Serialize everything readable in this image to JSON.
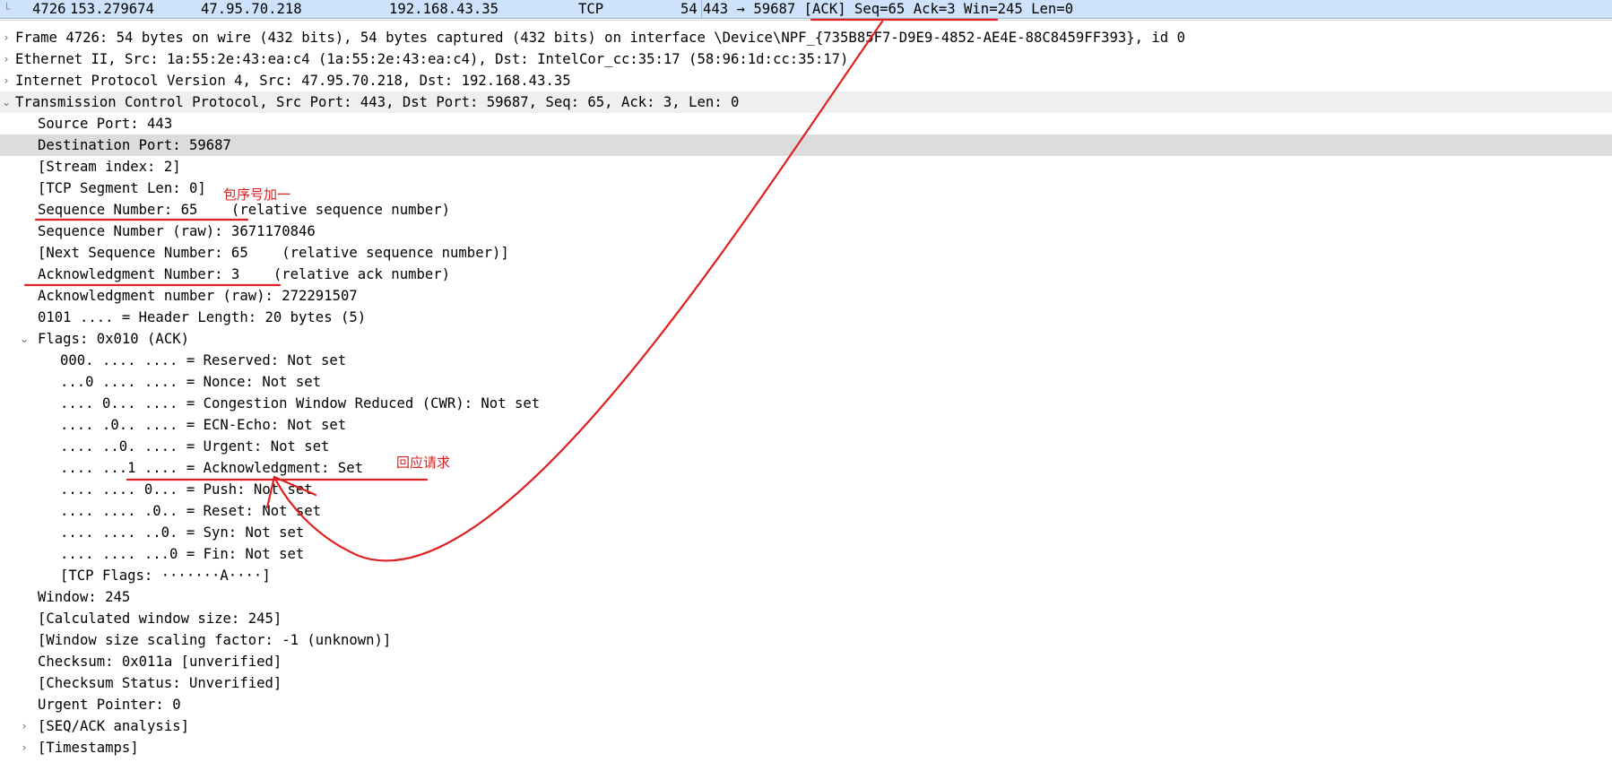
{
  "packet_list_row": {
    "number": "4726",
    "time": "153.279674",
    "source": "47.95.70.218",
    "destination": "192.168.43.35",
    "protocol": "TCP",
    "length": "54",
    "info": "443 → 59687 [ACK] Seq=65 Ack=3 Win=245 Len=0"
  },
  "tree": [
    {
      "text": "Frame 4726: 54 bytes on wire (432 bits), 54 bytes captured (432 bits) on interface \\Device\\NPF_{735B85F7-D9E9-4852-AE4E-88C8459FF393}, id 0",
      "depth": 0,
      "toggle": "collapsed"
    },
    {
      "text": "Ethernet II, Src: 1a:55:2e:43:ea:c4 (1a:55:2e:43:ea:c4), Dst: IntelCor_cc:35:17 (58:96:1d:cc:35:17)",
      "depth": 0,
      "toggle": "collapsed"
    },
    {
      "text": "Internet Protocol Version 4, Src: 47.95.70.218, Dst: 192.168.43.35",
      "depth": 0,
      "toggle": "collapsed"
    },
    {
      "text": "Transmission Control Protocol, Src Port: 443, Dst Port: 59687, Seq: 65, Ack: 3, Len: 0",
      "depth": 0,
      "toggle": "expanded"
    },
    {
      "text": "Source Port: 443",
      "depth": 1
    },
    {
      "text": "Destination Port: 59687",
      "depth": 1,
      "selected": true
    },
    {
      "text": "[Stream index: 2]",
      "depth": 1
    },
    {
      "text": "[TCP Segment Len: 0]",
      "depth": 1
    },
    {
      "text": "Sequence Number: 65    (relative sequence number)",
      "depth": 1
    },
    {
      "text": "Sequence Number (raw): 3671170846",
      "depth": 1
    },
    {
      "text": "[Next Sequence Number: 65    (relative sequence number)]",
      "depth": 1
    },
    {
      "text": "Acknowledgment Number: 3    (relative ack number)",
      "depth": 1
    },
    {
      "text": "Acknowledgment number (raw): 272291507",
      "depth": 1
    },
    {
      "text": "0101 .... = Header Length: 20 bytes (5)",
      "depth": 1
    },
    {
      "text": "Flags: 0x010 (ACK)",
      "depth": 1,
      "toggle": "expanded"
    },
    {
      "text": "000. .... .... = Reserved: Not set",
      "depth": 2
    },
    {
      "text": "...0 .... .... = Nonce: Not set",
      "depth": 2
    },
    {
      "text": ".... 0... .... = Congestion Window Reduced (CWR): Not set",
      "depth": 2
    },
    {
      "text": ".... .0.. .... = ECN-Echo: Not set",
      "depth": 2
    },
    {
      "text": ".... ..0. .... = Urgent: Not set",
      "depth": 2
    },
    {
      "text": ".... ...1 .... = Acknowledgment: Set",
      "depth": 2
    },
    {
      "text": ".... .... 0... = Push: Not set",
      "depth": 2
    },
    {
      "text": ".... .... .0.. = Reset: Not set",
      "depth": 2
    },
    {
      "text": ".... .... ..0. = Syn: Not set",
      "depth": 2
    },
    {
      "text": ".... .... ...0 = Fin: Not set",
      "depth": 2
    },
    {
      "text": "[TCP Flags: ·······A····]",
      "depth": 2
    },
    {
      "text": "Window: 245",
      "depth": 1
    },
    {
      "text": "[Calculated window size: 245]",
      "depth": 1
    },
    {
      "text": "[Window size scaling factor: -1 (unknown)]",
      "depth": 1
    },
    {
      "text": "Checksum: 0x011a [unverified]",
      "depth": 1
    },
    {
      "text": "[Checksum Status: Unverified]",
      "depth": 1
    },
    {
      "text": "Urgent Pointer: 0",
      "depth": 1
    },
    {
      "text": "[SEQ/ACK analysis]",
      "depth": 1,
      "toggle": "collapsed"
    },
    {
      "text": "[Timestamps]",
      "depth": 1,
      "toggle": "collapsed"
    }
  ],
  "annotations": {
    "seq_note": "包序号加一",
    "ack_note": "回应请求"
  },
  "colors": {
    "annotation": "#e02020",
    "selected_packet": "#cfe2fb",
    "selected_field": "#dcdcdc"
  }
}
